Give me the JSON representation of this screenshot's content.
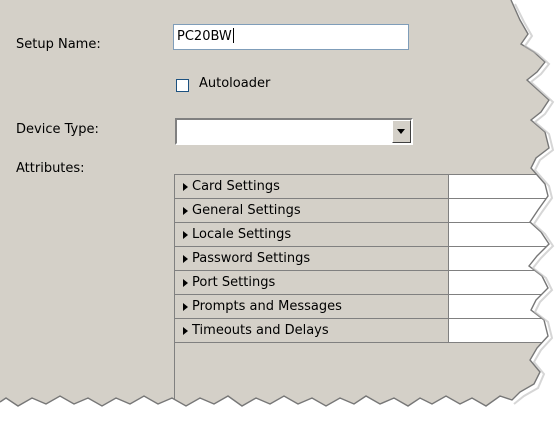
{
  "form": {
    "setup_name_label": "Setup Name:",
    "setup_name_value": "PC20BW",
    "autoloader_label": "Autoloader",
    "autoloader_checked": false,
    "device_type_label": "Device Type:",
    "device_type_value": "",
    "attributes_label": "Attributes:"
  },
  "attributes": [
    {
      "label": "Card Settings",
      "value": ""
    },
    {
      "label": "General Settings",
      "value": ""
    },
    {
      "label": "Locale Settings",
      "value": ""
    },
    {
      "label": "Password Settings",
      "value": ""
    },
    {
      "label": "Port Settings",
      "value": ""
    },
    {
      "label": "Prompts and Messages",
      "value": ""
    },
    {
      "label": "Timeouts and Delays",
      "value": ""
    }
  ],
  "colors": {
    "panel": "#d4d0c8",
    "input_border": "#7f9db9",
    "grid_line": "#808080"
  },
  "icons": {
    "row_expander": "triangle-right-icon",
    "dropdown": "chevron-down-icon"
  }
}
